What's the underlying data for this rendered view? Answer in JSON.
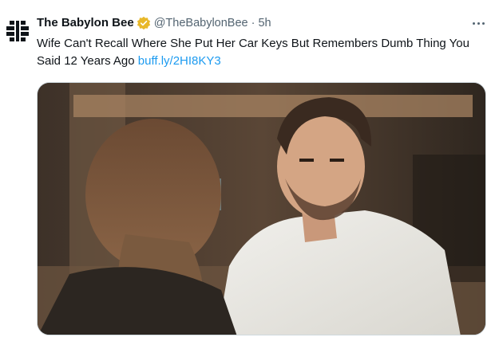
{
  "tweet": {
    "display_name": "The Babylon Bee",
    "handle": "@TheBabylonBee",
    "separator": "·",
    "time": "5h",
    "text": "Wife Can't Recall Where She Put Her Car Keys But Remembers Dumb Thing You Said 12 Years Ago ",
    "link_text": "buff.ly/2HI8KY3",
    "verified_icon": "verified-badge-icon",
    "more_icon": "more-options-icon",
    "avatar_icon": "babylon-bee-logo",
    "media_description_icon": "photo"
  },
  "colors": {
    "link": "#1d9bf0",
    "secondary_text": "#536471",
    "verified_gold": "#e8b829",
    "border": "#cfd9de"
  }
}
